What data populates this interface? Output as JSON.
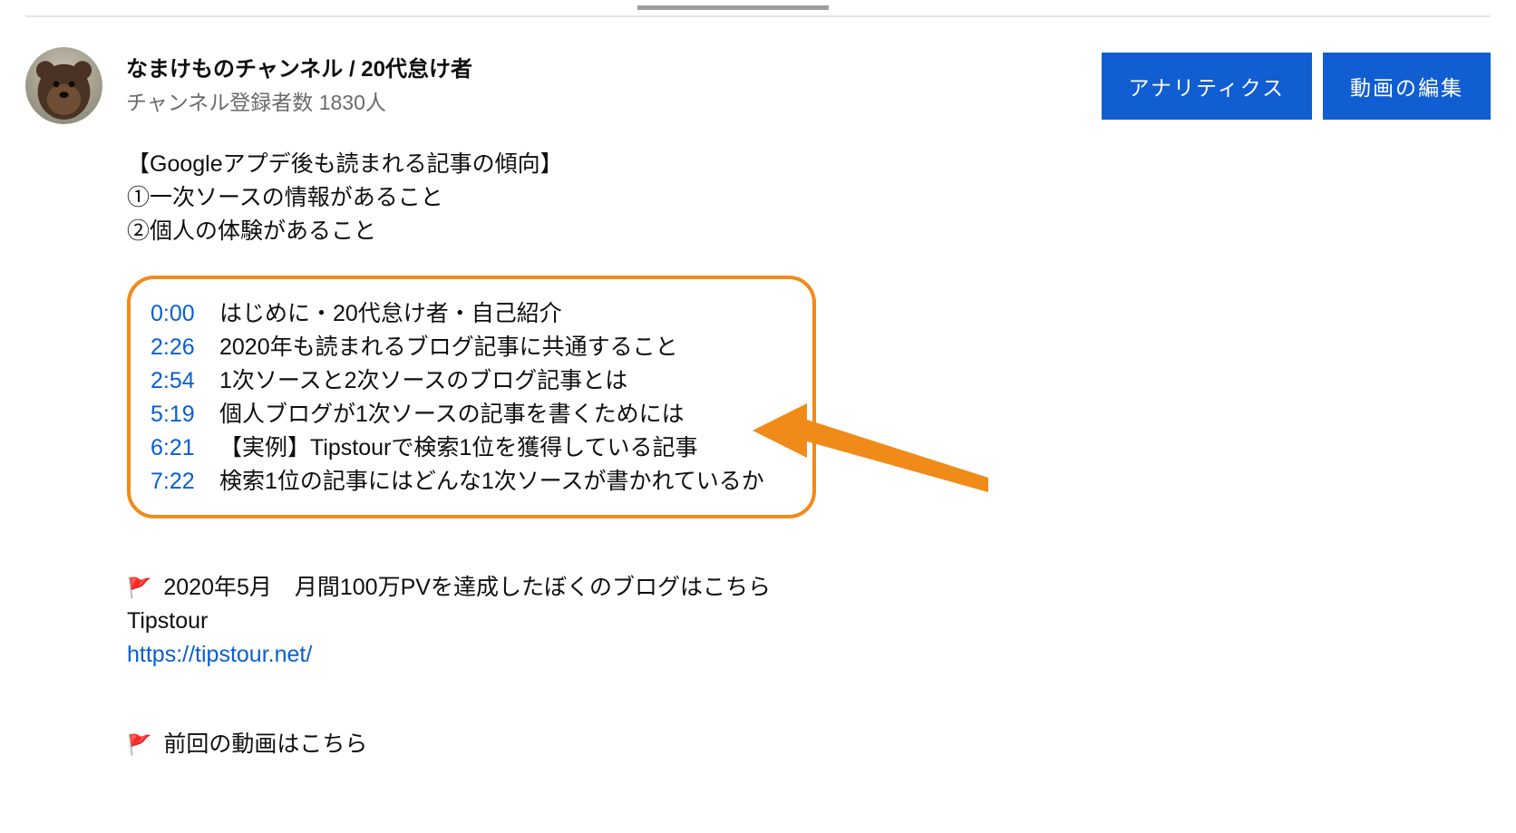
{
  "header": {
    "channel_name": "なまけものチャンネル / 20代怠け者",
    "subscribers": "チャンネル登録者数 1830人",
    "buttons": {
      "analytics": "アナリティクス",
      "edit_video": "動画の編集"
    }
  },
  "description": {
    "title_line": "【Googleアプデ後も読まれる記事の傾向】",
    "point1": "①一次ソースの情報があること",
    "point2": "②個人の体験があること"
  },
  "chapters": [
    {
      "ts": "0:00",
      "label": "はじめに・20代怠け者・自己紹介"
    },
    {
      "ts": "2:26",
      "label": "2020年も読まれるブログ記事に共通すること"
    },
    {
      "ts": "2:54",
      "label": "1次ソースと2次ソースのブログ記事とは"
    },
    {
      "ts": "5:19",
      "label": "個人ブログが1次ソースの記事を書くためには"
    },
    {
      "ts": "6:21",
      "label": "【実例】Tipstourで検索1位を獲得している記事"
    },
    {
      "ts": "7:22",
      "label": "検索1位の記事にはどんな1次ソースが書かれているか"
    }
  ],
  "blog_promo": {
    "flag": "🚩",
    "headline": "2020年5月　月間100万PVを達成したぼくのブログはこちら",
    "name": "Tipstour",
    "url": "https://tipstour.net/"
  },
  "prev_video": {
    "flag": "🚩",
    "label": "前回の動画はこちら"
  }
}
